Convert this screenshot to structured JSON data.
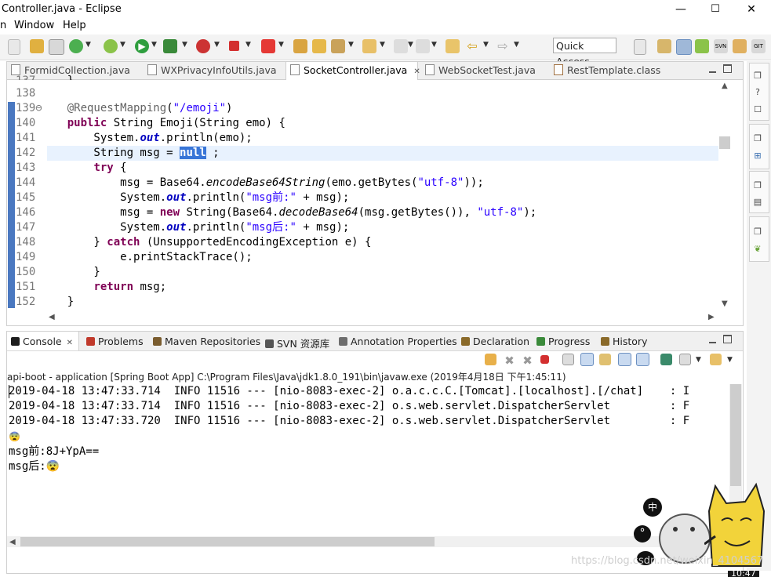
{
  "window": {
    "title": "Controller.java - Eclipse",
    "min_glyph": "—",
    "max_glyph": "☐",
    "close_glyph": "✕"
  },
  "menu": [
    "n",
    "Window",
    "Help"
  ],
  "toolbar": {
    "quick_access": "Quick Access"
  },
  "editor": {
    "tabs": [
      {
        "label": "FormidCollection.java",
        "active": false
      },
      {
        "label": "WXPrivacyInfoUtils.java",
        "active": false
      },
      {
        "label": "SocketController.java",
        "active": true,
        "close": "✕"
      },
      {
        "label": "WebSocketTest.java",
        "active": false
      },
      {
        "label": "RestTemplate.class",
        "active": false
      }
    ],
    "lines": [
      {
        "n": "137",
        "code": "    }"
      },
      {
        "n": "138",
        "code": ""
      },
      {
        "n": "139⊖",
        "code": "    @RequestMapping(\"/emoji\")"
      },
      {
        "n": "140",
        "code": "    public String Emoji(String emo) {"
      },
      {
        "n": "141",
        "code": "        System.out.println(emo);"
      },
      {
        "n": "142",
        "code": "        String msg = null ;"
      },
      {
        "n": "143",
        "code": "        try {"
      },
      {
        "n": "144",
        "code": "            msg = Base64.encodeBase64String(emo.getBytes(\"utf-8\"));"
      },
      {
        "n": "145",
        "code": "            System.out.println(\"msg前:\" + msg);"
      },
      {
        "n": "146",
        "code": "            msg = new String(Base64.decodeBase64(msg.getBytes()), \"utf-8\");"
      },
      {
        "n": "147",
        "code": "            System.out.println(\"msg后:\" + msg);"
      },
      {
        "n": "148",
        "code": "        } catch (UnsupportedEncodingException e) {"
      },
      {
        "n": "149",
        "code": "            e.printStackTrace();"
      },
      {
        "n": "150",
        "code": "        }"
      },
      {
        "n": "151",
        "code": "        return msg;"
      },
      {
        "n": "152",
        "code": "    }"
      }
    ],
    "current_line": "142",
    "selected_text": "null"
  },
  "console": {
    "tabs": [
      {
        "label": "Console",
        "active": true,
        "close": "✕",
        "color": "#1d1d1d"
      },
      {
        "label": "Problems",
        "color": "#c0392b"
      },
      {
        "label": "Maven Repositories",
        "color": "#7a5c2e"
      },
      {
        "label": "SVN 资源库",
        "color": "#555555"
      },
      {
        "label": "Annotation Properties",
        "color": "#6d6d6d"
      },
      {
        "label": "Declaration",
        "color": "#8a6a2a"
      },
      {
        "label": "Progress",
        "color": "#3a8a3a"
      },
      {
        "label": "History",
        "color": "#8a6a2a"
      }
    ],
    "description": "api-boot - application [Spring Boot App] C:\\Program Files\\Java\\jdk1.8.0_191\\bin\\javaw.exe (2019年4月18日 下午1:45:11)",
    "lines": [
      "2019-04-18 13:47:33.714  INFO 11516 --- [nio-8083-exec-2] o.a.c.c.C.[Tomcat].[localhost].[/chat]    : I",
      "2019-04-18 13:47:33.714  INFO 11516 --- [nio-8083-exec-2] o.s.web.servlet.DispatcherServlet         : F",
      "2019-04-18 13:47:33.720  INFO 11516 --- [nio-8083-exec-2] o.s.web.servlet.DispatcherServlet         : F",
      "😨",
      "msg前:8J+YpA==",
      "msg后:😨"
    ]
  },
  "overlay": {
    "watermark": "https://blog.csdn.net/weixin_4104567",
    "ime_label": "中",
    "ime_glyph": "°",
    "clock_fragment": "10:47"
  },
  "colors": {
    "keyword": "#7f0055",
    "string": "#2a00ff",
    "field": "#0000c0",
    "selection": "#3875d7",
    "current_line": "#e8f2fe",
    "ruler_mark": "#4a78c0"
  }
}
